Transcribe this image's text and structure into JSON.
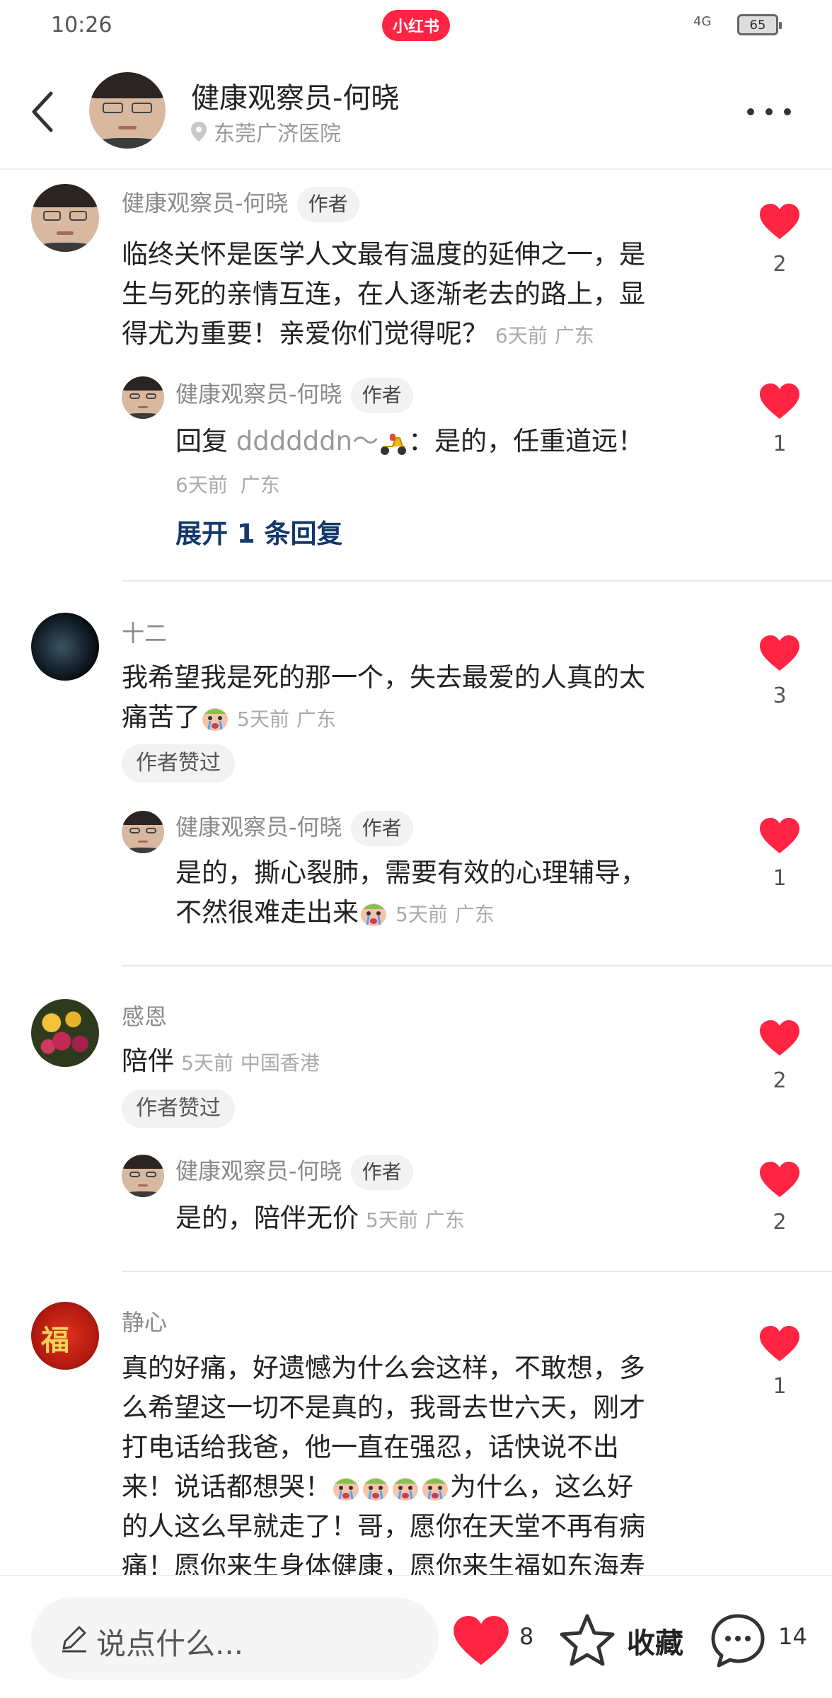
{
  "status_bar": {
    "time": "10:26",
    "app_badge": "小红书",
    "network": "4G",
    "battery": "65"
  },
  "header": {
    "title": "健康观察员-何晓",
    "location": "东莞广济医院"
  },
  "author_tag": "作者",
  "liked_by_author": "作者赞过",
  "comments": [
    {
      "name": "健康观察员-何晓",
      "text_lines": [
        "临终关怀是医学人文最有温度的延伸之一，是",
        "生与死的亲情互连，在人逐渐老去的路上，显",
        "得尤为重要！亲爱你们觉得呢？"
      ],
      "time": "6天前",
      "region": "广东",
      "likes": "2",
      "reply": {
        "name": "健康观察员-何晓",
        "prefix": "回复",
        "mention": "ddddddn～",
        "text": "：是的，任重道远！",
        "time": "6天前",
        "region": "广东",
        "likes": "1"
      },
      "expand": "展开 1 条回复"
    },
    {
      "name": "十二",
      "text_lines": [
        "我希望我是死的那一个，失去最爱的人真的太",
        "痛苦了"
      ],
      "time": "5天前",
      "region": "广东",
      "likes": "3",
      "reply": {
        "name": "健康观察员-何晓",
        "text_lines": [
          "是的，撕心裂肺，需要有效的心理辅导，",
          "不然很难走出来"
        ],
        "time": "5天前",
        "region": "广东",
        "likes": "1"
      }
    },
    {
      "name": "感恩",
      "text": "陪伴",
      "time": "5天前",
      "region": "中国香港",
      "likes": "2",
      "reply": {
        "name": "健康观察员-何晓",
        "text": "是的，陪伴无价",
        "time": "5天前",
        "region": "广东",
        "likes": "2"
      }
    },
    {
      "name": "静心",
      "text_lines": [
        "真的好痛，好遗憾为什么会这样，不敢想，多",
        "么希望这一切不是真的，我哥去世六天，刚才",
        "打电话给我爸，他一直在强忍，话快说不出",
        "来！说话都想哭！",
        "为什么，这么好",
        "的人这么早就走了！哥，愿你在天堂不再有病",
        "痛！愿你来生身体健康，愿你来生福如东海寿"
      ],
      "likes": "1"
    }
  ],
  "bottom_bar": {
    "input_placeholder": "说点什么...",
    "likes": "8",
    "collect_label": "收藏",
    "comments": "14"
  },
  "colors": {
    "brand": "#ff2442",
    "link": "#13386c",
    "heart": "#ff2442"
  },
  "icons": [
    "back-icon",
    "location-icon",
    "more-icon",
    "heart-icon",
    "crying-emoji",
    "scooter-emoji",
    "pencil-icon",
    "star-icon",
    "chat-icon"
  ]
}
